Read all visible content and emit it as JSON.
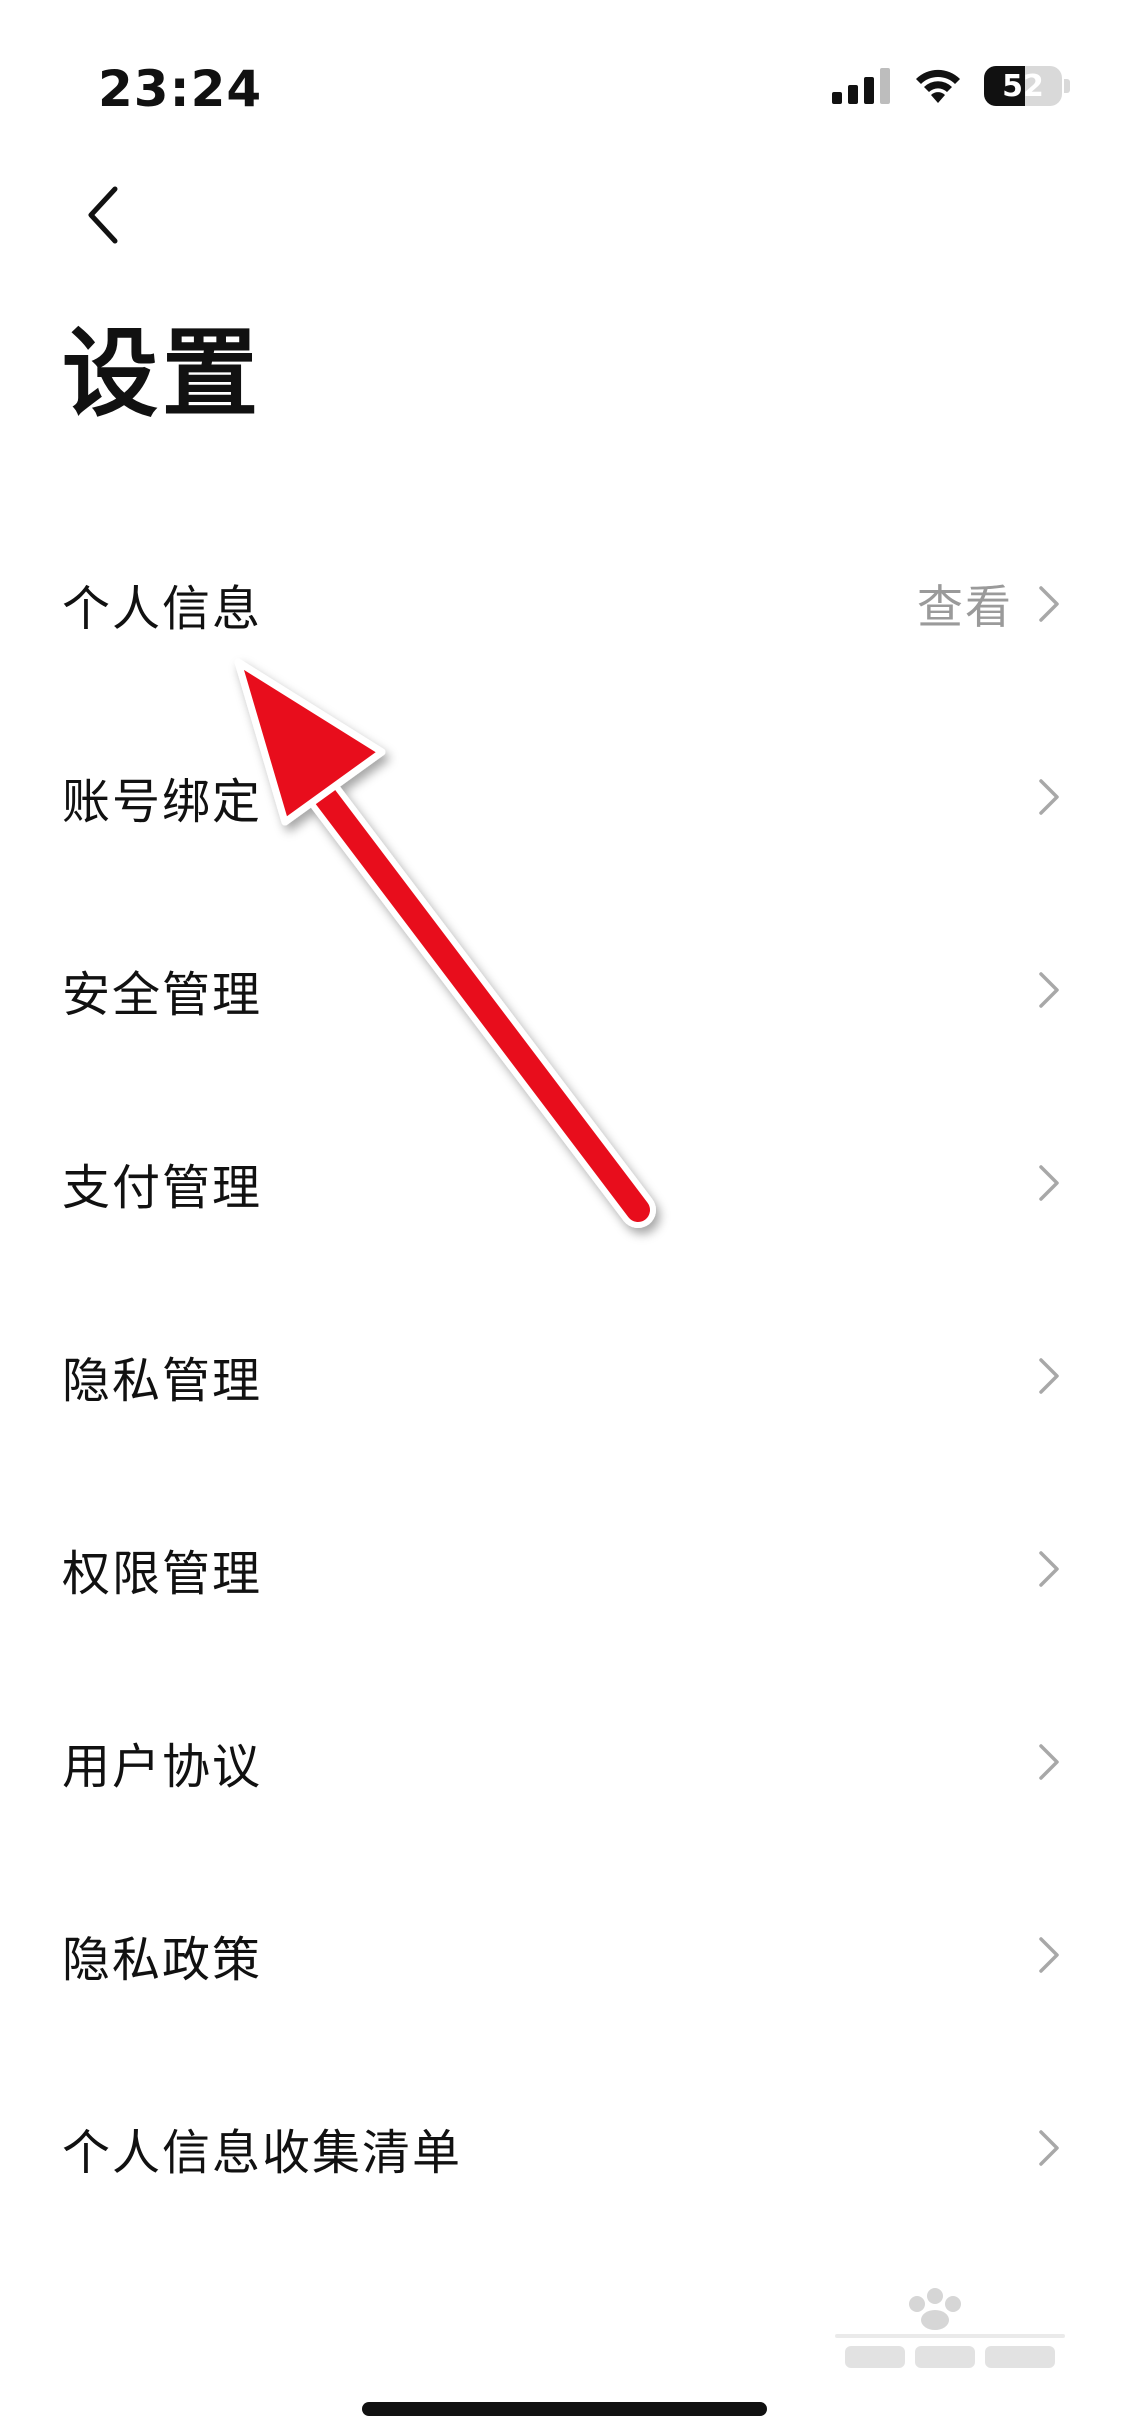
{
  "status_bar": {
    "time": "23:24",
    "battery_level": "52",
    "battery_fraction": 0.52
  },
  "header": {
    "title": "设置",
    "back_icon": "chevron-left-icon"
  },
  "settings": {
    "items": [
      {
        "label": "个人信息",
        "value": "查看"
      },
      {
        "label": "账号绑定",
        "value": ""
      },
      {
        "label": "安全管理",
        "value": ""
      },
      {
        "label": "支付管理",
        "value": ""
      },
      {
        "label": "隐私管理",
        "value": ""
      },
      {
        "label": "权限管理",
        "value": ""
      },
      {
        "label": "用户协议",
        "value": ""
      },
      {
        "label": "隐私政策",
        "value": ""
      },
      {
        "label": "个人信息收集清单",
        "value": ""
      }
    ]
  },
  "colors": {
    "text": "#111111",
    "secondary_text": "#9a9a9a",
    "chevron": "#a8a8a8",
    "annotation_arrow": "#e8101e",
    "background": "#ffffff"
  },
  "watermark": {
    "icon": "baidu-jingyan-logo"
  }
}
